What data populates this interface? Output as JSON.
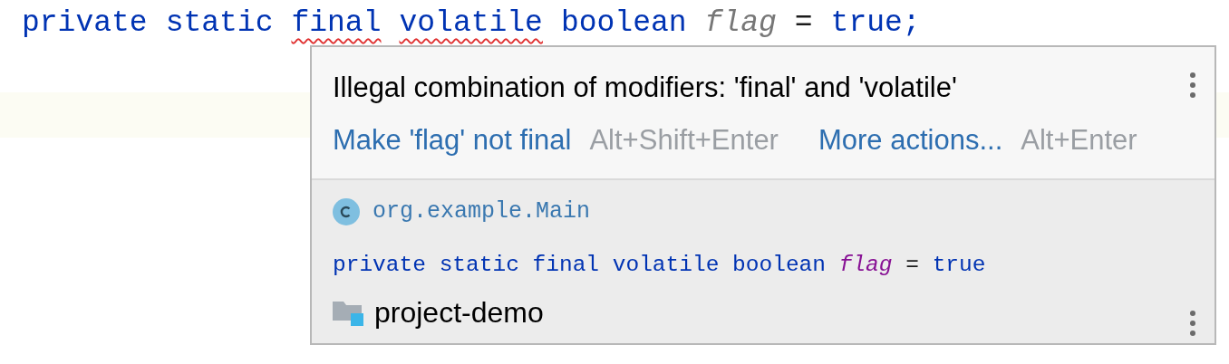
{
  "editor": {
    "code_line": [
      {
        "text": "private",
        "kind": "keyword",
        "error": false
      },
      {
        "text": "static",
        "kind": "keyword",
        "error": false
      },
      {
        "text": "final",
        "kind": "keyword",
        "error": true
      },
      {
        "text": "volatile",
        "kind": "keyword",
        "error": true
      },
      {
        "text": "boolean",
        "kind": "keyword",
        "error": false
      },
      {
        "text": "flag",
        "kind": "field",
        "error": false
      },
      {
        "text": "=",
        "kind": "plain",
        "error": false
      },
      {
        "text": "true;",
        "kind": "keyword",
        "error": false
      }
    ]
  },
  "popup": {
    "message": "Illegal combination of modifiers: 'final' and 'volatile'",
    "actions": [
      {
        "label": "Make 'flag' not final",
        "shortcut": "Alt+Shift+Enter"
      },
      {
        "label": "More actions...",
        "shortcut": "Alt+Enter"
      }
    ],
    "class_name": "org.example.Main",
    "declaration": [
      {
        "text": "private",
        "kind": "keyword"
      },
      {
        "text": "static",
        "kind": "keyword"
      },
      {
        "text": "final",
        "kind": "keyword"
      },
      {
        "text": "volatile",
        "kind": "keyword"
      },
      {
        "text": "boolean",
        "kind": "keyword"
      },
      {
        "text": "flag",
        "kind": "field"
      },
      {
        "text": "=",
        "kind": "plain"
      },
      {
        "text": "true",
        "kind": "keyword"
      }
    ],
    "module": "project-demo"
  }
}
